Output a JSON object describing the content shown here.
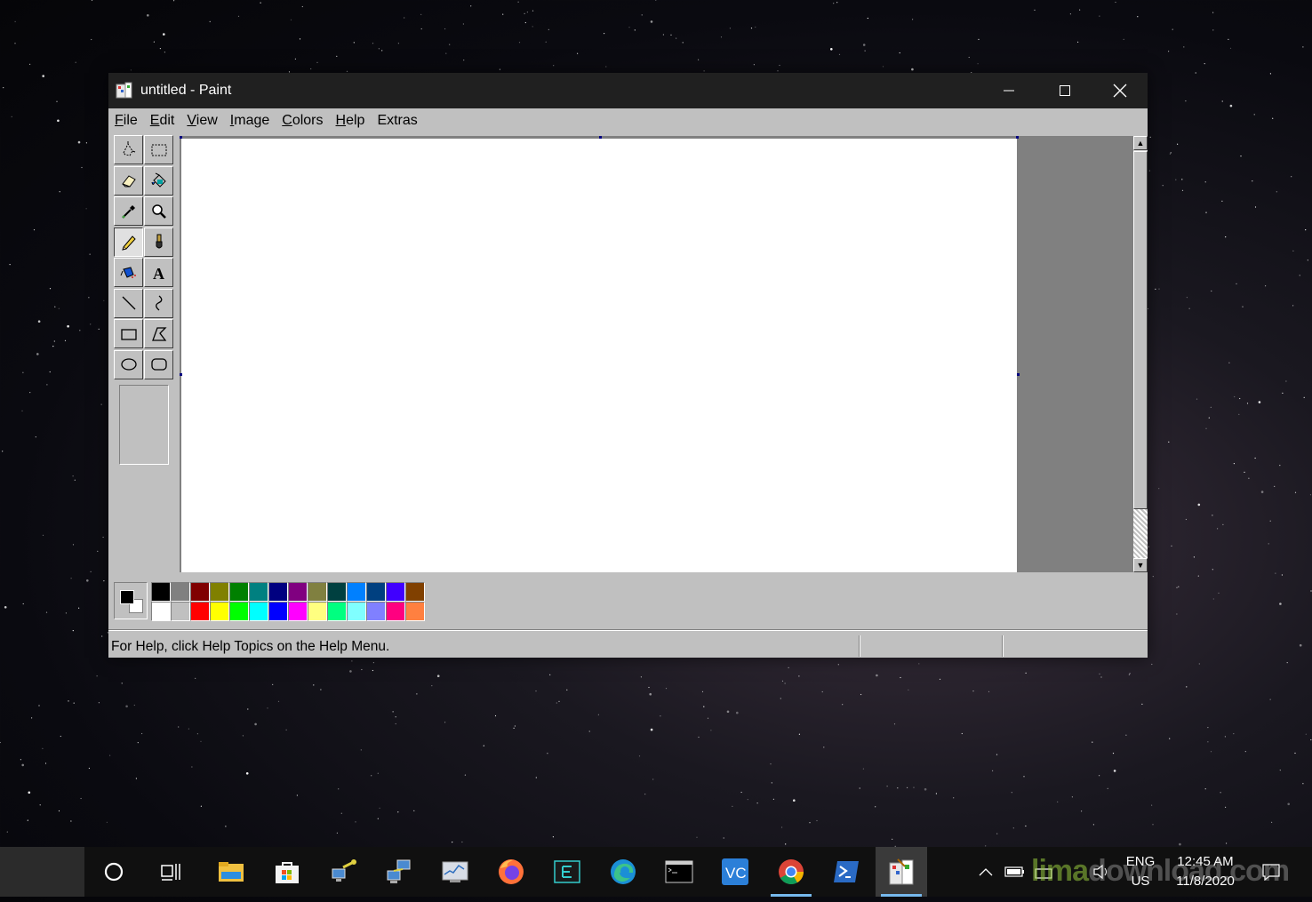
{
  "window": {
    "title": "untitled - Paint",
    "buttons": {
      "minimize": "minimize",
      "maximize": "maximize",
      "close": "close"
    }
  },
  "menu": [
    {
      "acc": "F",
      "rest": "ile"
    },
    {
      "acc": "E",
      "rest": "dit"
    },
    {
      "acc": "V",
      "rest": "iew"
    },
    {
      "acc": "I",
      "rest": "mage"
    },
    {
      "acc": "C",
      "rest": "olors"
    },
    {
      "acc": "H",
      "rest": "elp"
    },
    {
      "acc": "",
      "rest": "Extras"
    }
  ],
  "tools": [
    {
      "name": "free-form-select",
      "active": false
    },
    {
      "name": "select",
      "active": false
    },
    {
      "name": "eraser",
      "active": false
    },
    {
      "name": "fill-with-color",
      "active": false
    },
    {
      "name": "pick-color",
      "active": false
    },
    {
      "name": "magnifier",
      "active": false
    },
    {
      "name": "pencil",
      "active": true
    },
    {
      "name": "brush",
      "active": false
    },
    {
      "name": "airbrush",
      "active": false
    },
    {
      "name": "text",
      "active": false
    },
    {
      "name": "line",
      "active": false
    },
    {
      "name": "curve",
      "active": false
    },
    {
      "name": "rectangle",
      "active": false
    },
    {
      "name": "polygon",
      "active": false
    },
    {
      "name": "ellipse",
      "active": false
    },
    {
      "name": "rounded-rectangle",
      "active": false
    }
  ],
  "current_colors": {
    "foreground": "#000000",
    "background": "#ffffff"
  },
  "palette": {
    "row1": [
      "#000000",
      "#808080",
      "#800000",
      "#808000",
      "#008000",
      "#008080",
      "#000080",
      "#800080",
      "#808040",
      "#004040",
      "#0080ff",
      "#004080",
      "#4000ff",
      "#804000"
    ],
    "row2": [
      "#ffffff",
      "#c0c0c0",
      "#ff0000",
      "#ffff00",
      "#00ff00",
      "#00ffff",
      "#0000ff",
      "#ff00ff",
      "#ffff80",
      "#00ff80",
      "#80ffff",
      "#8080ff",
      "#ff0080",
      "#ff8040"
    ]
  },
  "status": {
    "help_text": "For Help, click Help Topics on the Help Menu."
  },
  "taskbar": {
    "apps": [
      "cortana-icon",
      "task-view-icon",
      "file-explorer-icon",
      "microsoft-store-icon",
      "network-tool-icon",
      "network-connections-icon",
      "performance-monitor-icon",
      "firefox-icon",
      "editor-icon",
      "edge-icon",
      "terminal-icon",
      "vscode-icon",
      "chrome-icon",
      "powershell-icon",
      "paint-icon"
    ],
    "language": {
      "top": "ENG",
      "bottom": "US"
    },
    "clock": {
      "time": "12:45 AM",
      "date": "11/8/2020"
    }
  },
  "watermark": {
    "text_a": "lima",
    "text_b": "download.com"
  }
}
